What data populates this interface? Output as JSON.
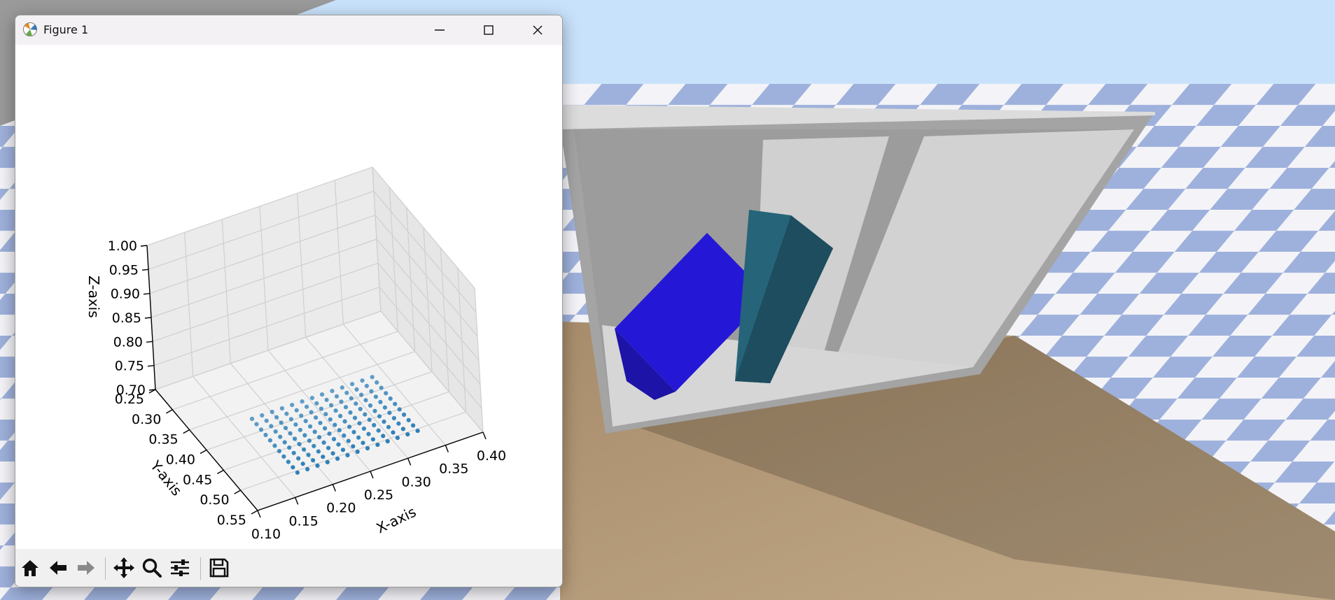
{
  "window": {
    "title": "Figure 1",
    "icon": "matplotlib-icon",
    "controls": [
      "minimize-icon",
      "maximize-icon",
      "close-icon"
    ]
  },
  "toolbar": {
    "tools": [
      "home-icon",
      "back-arrow-icon",
      "forward-arrow-icon",
      "pan-icon",
      "zoom-icon",
      "configure-subplots-icon",
      "save-icon"
    ]
  },
  "chart_data": {
    "type": "scatter",
    "projection": "3d",
    "xlabel": "X-axis",
    "ylabel": "Y-axis",
    "zlabel": "Z-axis",
    "xlim": [
      0.1,
      0.4
    ],
    "ylim": [
      0.25,
      0.55
    ],
    "zlim": [
      0.7,
      1.0
    ],
    "xticks": [
      "0.10",
      "0.15",
      "0.20",
      "0.25",
      "0.30",
      "0.35",
      "0.40"
    ],
    "yticks": [
      "0.25",
      "0.30",
      "0.35",
      "0.40",
      "0.45",
      "0.50",
      "0.55"
    ],
    "zticks": [
      "0.70",
      "0.75",
      "0.80",
      "0.85",
      "0.90",
      "0.95",
      "1.00"
    ],
    "grid": true,
    "color": "#1f77b4",
    "points": {
      "x": [
        0.17,
        0.1833,
        0.1967,
        0.21,
        0.2233,
        0.2367,
        0.25,
        0.2633,
        0.2767,
        0.29,
        0.3033,
        0.3167,
        0.33
      ],
      "y": [
        0.38,
        0.3933,
        0.4067,
        0.42,
        0.4333,
        0.4467,
        0.46,
        0.4733,
        0.4867,
        0.5,
        0.5133
      ],
      "z": 0.71
    }
  },
  "scene": {
    "description_colors": {
      "sky": "#c9e2fb",
      "floor": "#b39a78",
      "bin": "#cfcfcf",
      "blue_block": "#2418d6",
      "teal_block": "#266479"
    }
  }
}
